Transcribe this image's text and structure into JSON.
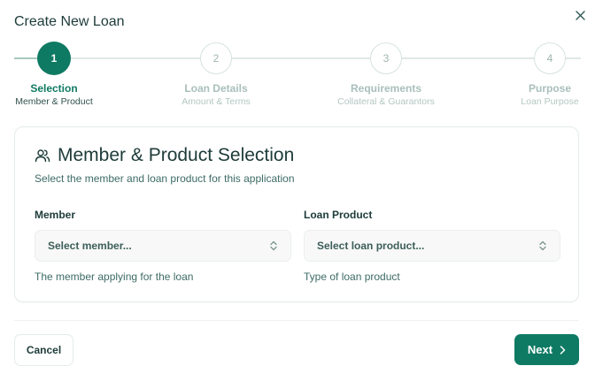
{
  "dialog": {
    "title": "Create New Loan"
  },
  "stepper": {
    "steps": [
      {
        "number": "1",
        "label": "Selection",
        "sublabel": "Member & Product",
        "state": "active"
      },
      {
        "number": "2",
        "label": "Loan Details",
        "sublabel": "Amount & Terms",
        "state": "pending"
      },
      {
        "number": "3",
        "label": "Requirements",
        "sublabel": "Collateral & Guarantors",
        "state": "pending"
      },
      {
        "number": "4",
        "label": "Purpose",
        "sublabel": "Loan Purpose",
        "state": "pending"
      }
    ]
  },
  "card": {
    "icon": "users-icon",
    "title": "Member & Product Selection",
    "subtitle": "Select the member and loan product for this application",
    "member": {
      "label": "Member",
      "placeholder": "Select member...",
      "help": "The member applying for the loan"
    },
    "product": {
      "label": "Loan Product",
      "placeholder": "Select loan product...",
      "help": "Type of loan product"
    }
  },
  "footer": {
    "cancel_label": "Cancel",
    "next_label": "Next"
  },
  "colors": {
    "accent": "#0f7a63",
    "text": "#1d3b39",
    "muted": "#3d6b66"
  }
}
